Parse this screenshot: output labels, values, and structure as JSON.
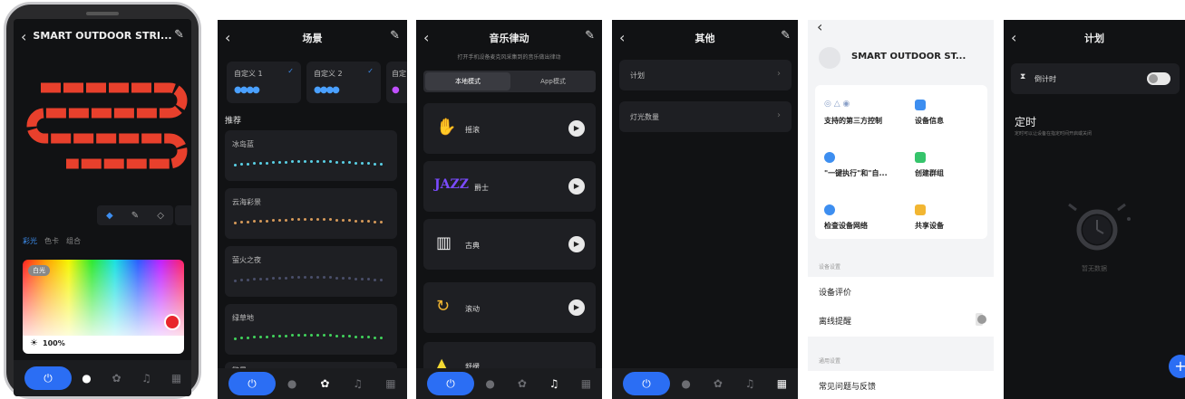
{
  "screen1": {
    "title": "SMART OUTDOOR STRI...",
    "tabs": [
      "彩光",
      "色卡",
      "组合"
    ],
    "picker_tag": "白光",
    "brightness": "100%",
    "brightness_value": 1.0
  },
  "screen2": {
    "title": "场景",
    "custom": [
      {
        "label": "自定义 1"
      },
      {
        "label": "自定义 2"
      },
      {
        "label": "自定"
      }
    ],
    "recommend_title": "推荐",
    "scenes": [
      {
        "label": "冰岛蓝",
        "color": "#5ad1e6"
      },
      {
        "label": "云海彩景",
        "color": "#d69a5a"
      },
      {
        "label": "萤火之夜",
        "color": "#4a4f6a"
      },
      {
        "label": "绿草地",
        "color": "#41d45c"
      },
      {
        "label": "繁星",
        "color": "#cccccc"
      }
    ]
  },
  "screen3": {
    "title": "音乐律动",
    "subtitle": "打开手机设备麦克风采集到的音乐做出律动",
    "tabs": [
      "本地模式",
      "App模式"
    ],
    "modes": [
      {
        "label": "摇滚",
        "icon": "rock-hand-icon"
      },
      {
        "label": "爵士",
        "icon": "jazz-icon"
      },
      {
        "label": "古典",
        "icon": "piano-icon"
      },
      {
        "label": "滚动",
        "icon": "rolling-icon"
      },
      {
        "label": "舒缓",
        "icon": "soft-icon"
      }
    ]
  },
  "screen4": {
    "title": "其他",
    "rows": [
      {
        "label": "计划"
      },
      {
        "label": "灯光数量"
      }
    ]
  },
  "screen5": {
    "title": "SMART OUTDOOR ST...",
    "grid": [
      {
        "label": "支持的第三方控制",
        "color": "#8aa0c8"
      },
      {
        "label": "设备信息",
        "color": "#3d8ef0"
      },
      {
        "label": "\"一键执行\"和\"自...",
        "color": "#3d8ef0"
      },
      {
        "label": "创建群组",
        "color": "#35c46b"
      },
      {
        "label": "检查设备网络",
        "color": "#3d8ef0"
      },
      {
        "label": "共享设备",
        "color": "#f2b632"
      }
    ],
    "section1": "设备设置",
    "rows1": [
      {
        "label": "设备评价"
      },
      {
        "label": "离线提醒"
      }
    ],
    "section2": "通用设置",
    "rows2": [
      {
        "label": "常见问题与反馈"
      }
    ]
  },
  "screen6": {
    "title": "计划",
    "countdown_label": "倒计时",
    "timer_title": "定时",
    "timer_desc": "定时可以让设备在指定时间开启或关闭",
    "empty_text": "暂无数据"
  }
}
